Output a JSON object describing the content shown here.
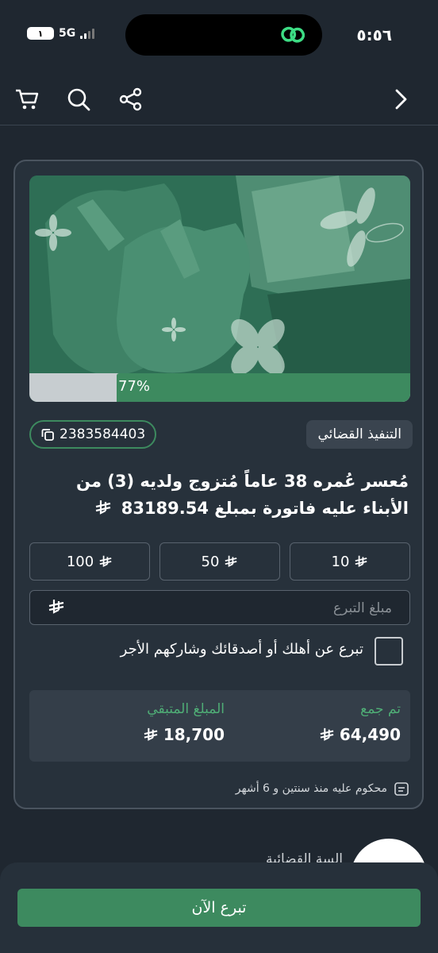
{
  "status_bar": {
    "time": "٥:٥٦",
    "battery": "١",
    "network": "5G"
  },
  "nav": {
    "icons": [
      "cart-icon",
      "search-icon",
      "share-icon",
      "chevron-right-icon"
    ]
  },
  "card": {
    "progress": {
      "percent_label": "77%",
      "value": 0.77
    },
    "category_tag": "التنفيذ القضائي",
    "case_code": "2383584403",
    "title": "مُعسر عُمره 38 عاماً مُتزوج ولديه (3) من الأبناء عليه فاتورة بمبلغ 83189.54",
    "amount_options": [
      "10",
      "50",
      "100"
    ],
    "donation_input": {
      "placeholder": "مبلغ التبرع",
      "value": ""
    },
    "gift_checkbox_label": "تبرع عن أهلك أو أصدقائك وشاركهم الأجر",
    "stats": {
      "collected_label": "تم جمع",
      "collected_value": "64,490",
      "remaining_label": "المبلغ المتبقي",
      "remaining_value": "18,700"
    },
    "sentence_info": "محكوم عليه منذ سنتين و 6 أشهر"
  },
  "below_card": {
    "partial_label": "السة القضائية"
  },
  "cta": {
    "donate_now": "تبرع الآن"
  },
  "colors": {
    "accent": "#3d8a5f",
    "background": "#1f2730",
    "card": "#27313b",
    "stat_label": "#4fae76"
  }
}
